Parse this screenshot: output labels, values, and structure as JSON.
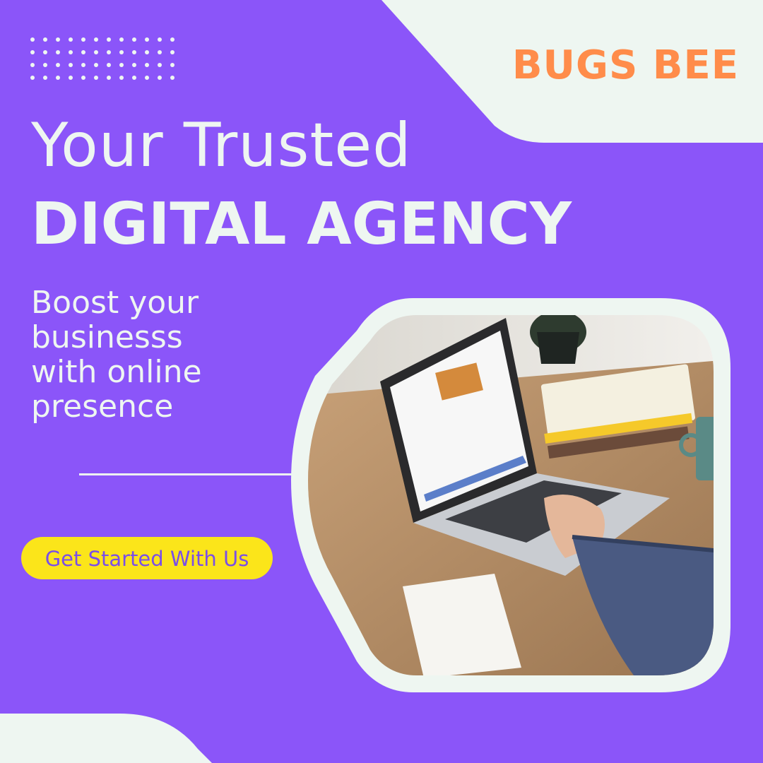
{
  "brand": {
    "name": "BUGS BEE",
    "color": "#ff8c4a"
  },
  "hero": {
    "headline_light": "Your Trusted",
    "headline_bold": "DIGITAL AGENCY",
    "subtitle_lines": [
      "Boost your",
      "businesss",
      "with online",
      "presence"
    ]
  },
  "cta": {
    "label": "Get Started With Us",
    "color": "#fbe51a"
  },
  "colors": {
    "background": "#8b55f9",
    "shape": "#eef6f1"
  },
  "photo": {
    "subject": "person typing on laptop at desk with books and mug"
  }
}
